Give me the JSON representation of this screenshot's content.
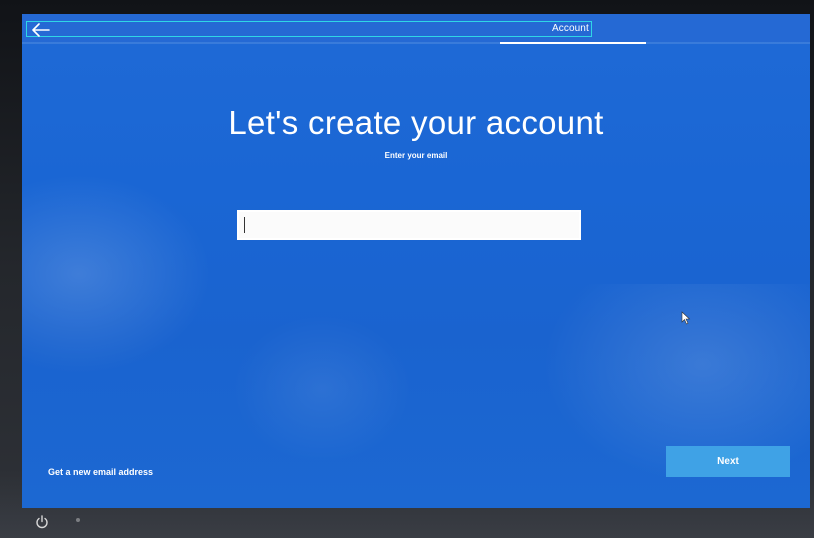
{
  "header": {
    "back_icon": "arrow-left-icon",
    "title": "Account"
  },
  "progress": {
    "filled_fraction": 0.19
  },
  "main": {
    "title": "Let's create your account",
    "subtitle": "Enter your email",
    "email_input": {
      "value": "",
      "placeholder": ""
    }
  },
  "footer": {
    "new_email_link": "Get a new email address",
    "next_label": "Next"
  },
  "taskbar": {
    "power_icon": "power-icon"
  },
  "colors": {
    "background": "#1a66d4",
    "button": "#3fa2e6",
    "focus_outline": "#2fd6e6"
  }
}
